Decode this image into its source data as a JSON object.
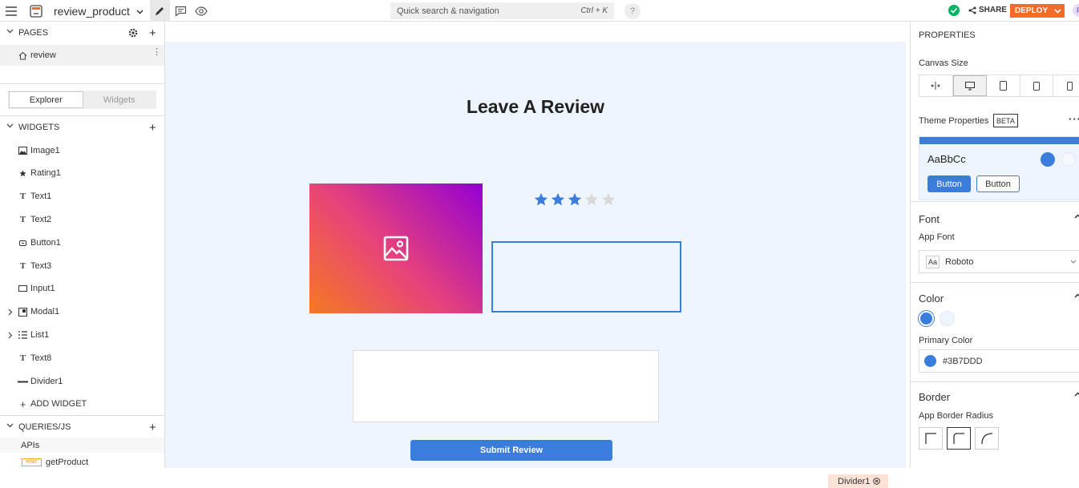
{
  "app": {
    "name": "review_product"
  },
  "topbar": {
    "search_placeholder": "Quick search & navigation",
    "search_shortcut": "Ctrl + K",
    "help": "?",
    "share": "SHARE",
    "deploy": "DEPLOY",
    "avatar": "P"
  },
  "sidebar": {
    "pages_header": "PAGES",
    "pages": [
      {
        "label": "review"
      }
    ],
    "tabs": {
      "explorer": "Explorer",
      "widgets": "Widgets"
    },
    "widgets_header": "WIDGETS",
    "widgets": [
      {
        "label": "Image1",
        "icon": "image-icon"
      },
      {
        "label": "Rating1",
        "icon": "star-icon"
      },
      {
        "label": "Text1",
        "icon": "text-icon"
      },
      {
        "label": "Text2",
        "icon": "text-icon"
      },
      {
        "label": "Button1",
        "icon": "button-icon"
      },
      {
        "label": "Text3",
        "icon": "text-icon"
      },
      {
        "label": "Input1",
        "icon": "input-icon"
      },
      {
        "label": "Modal1",
        "icon": "modal-icon"
      },
      {
        "label": "List1",
        "icon": "list-icon"
      },
      {
        "label": "Text8",
        "icon": "text-icon"
      },
      {
        "label": "Divider1",
        "icon": "divider-icon"
      }
    ],
    "add_widget": "ADD WIDGET",
    "queries_header": "QUERIES/JS",
    "apis_label": "APIs",
    "queries": [
      {
        "method": "POST",
        "label": "getProduct"
      }
    ]
  },
  "canvas": {
    "title": "Leave A Review",
    "rating": {
      "value": 3,
      "max": 5
    },
    "submit_label": "Submit Review",
    "selected_widget_tag": "Divider1"
  },
  "properties": {
    "header": "PROPERTIES",
    "canvas_size_label": "Canvas Size",
    "theme_label": "Theme Properties",
    "theme_badge": "BETA",
    "theme_preview_text": "AaBbCc",
    "theme_btn_primary": "Button",
    "theme_btn_secondary": "Button",
    "font_header": "Font",
    "app_font_label": "App Font",
    "app_font_prefix": "Aa",
    "app_font_value": "Roboto",
    "color_header": "Color",
    "primary_color_label": "Primary Color",
    "primary_color_value": "#3B7DDD",
    "border_header": "Border",
    "border_radius_label": "App Border Radius"
  },
  "colors": {
    "accent": "#3B7DDD",
    "deploy": "#F86A2B",
    "canvas_bg": "#EEF5FD"
  }
}
